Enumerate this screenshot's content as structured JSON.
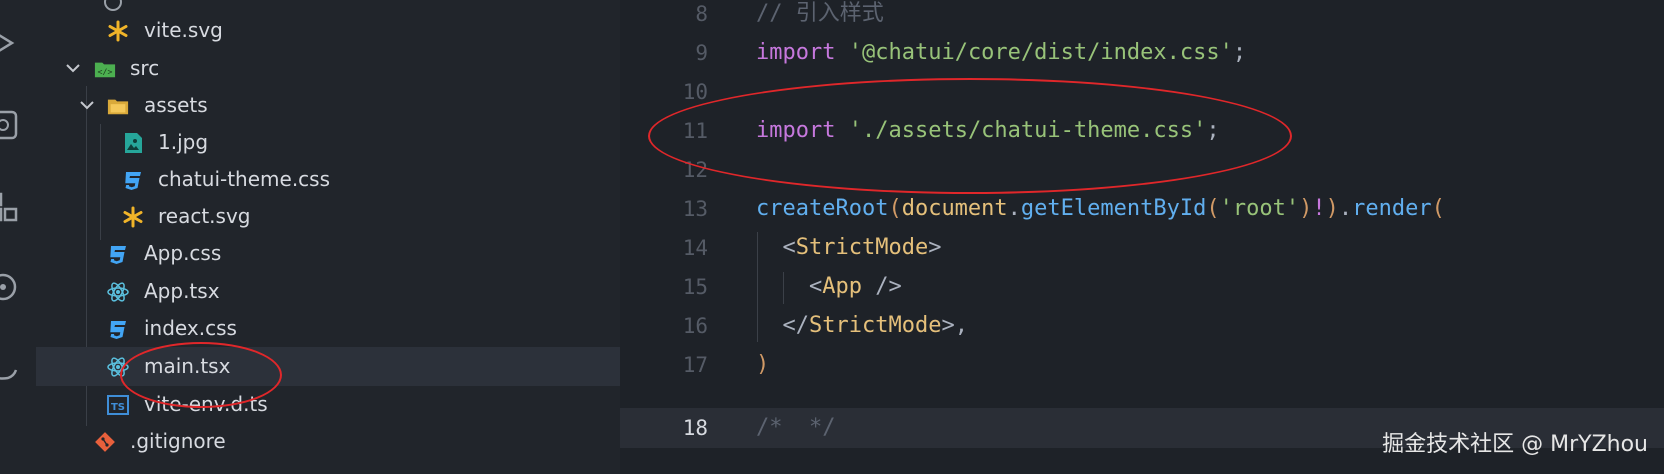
{
  "explorer": {
    "items": [
      {
        "name": "vite.svg",
        "icon": "svg-star-icon"
      },
      {
        "name": "src",
        "icon": "src-folder-icon"
      },
      {
        "name": "assets",
        "icon": "folder-open-icon"
      },
      {
        "name": "1.jpg",
        "icon": "image-file-icon"
      },
      {
        "name": "chatui-theme.css",
        "icon": "css-file-icon"
      },
      {
        "name": "react.svg",
        "icon": "svg-star-icon"
      },
      {
        "name": "App.css",
        "icon": "css-file-icon"
      },
      {
        "name": "App.tsx",
        "icon": "react-file-icon"
      },
      {
        "name": "index.css",
        "icon": "css-file-icon"
      },
      {
        "name": "main.tsx",
        "icon": "react-file-icon"
      },
      {
        "name": "vite-env.d.ts",
        "icon": "ts-file-icon"
      },
      {
        "name": ".gitignore",
        "icon": "git-file-icon"
      }
    ],
    "selected": "main.tsx"
  },
  "editor": {
    "current_line": "18",
    "lines": [
      {
        "n": "8",
        "tokens": [
          {
            "t": "// 引入样式",
            "c": "comment"
          }
        ]
      },
      {
        "n": "9",
        "tokens": [
          {
            "t": "import",
            "c": "kw"
          },
          {
            "t": " ",
            "c": "plain"
          },
          {
            "t": "'@chatui/core/dist/index.css'",
            "c": "str"
          },
          {
            "t": ";",
            "c": "plain"
          }
        ]
      },
      {
        "n": "10",
        "tokens": []
      },
      {
        "n": "11",
        "tokens": [
          {
            "t": "import",
            "c": "kw"
          },
          {
            "t": " ",
            "c": "plain"
          },
          {
            "t": "'./assets/chatui-theme.css'",
            "c": "str"
          },
          {
            "t": ";",
            "c": "plain"
          }
        ]
      },
      {
        "n": "12",
        "tokens": []
      },
      {
        "n": "13",
        "tokens": [
          {
            "t": "createRoot",
            "c": "fn"
          },
          {
            "t": "(",
            "c": "paren"
          },
          {
            "t": "document",
            "c": "var"
          },
          {
            "t": ".",
            "c": "plain"
          },
          {
            "t": "getElementById",
            "c": "fn"
          },
          {
            "t": "(",
            "c": "paren"
          },
          {
            "t": "'root'",
            "c": "str"
          },
          {
            "t": ")",
            "c": "paren"
          },
          {
            "t": "!",
            "c": "kw"
          },
          {
            "t": ")",
            "c": "paren"
          },
          {
            "t": ".",
            "c": "plain"
          },
          {
            "t": "render",
            "c": "fn"
          },
          {
            "t": "(",
            "c": "paren"
          }
        ]
      },
      {
        "n": "14",
        "tokens": [
          {
            "t": "  ",
            "c": "plain"
          },
          {
            "t": "<",
            "c": "plain"
          },
          {
            "t": "StrictMode",
            "c": "tag"
          },
          {
            "t": ">",
            "c": "plain"
          }
        ]
      },
      {
        "n": "15",
        "tokens": [
          {
            "t": "    ",
            "c": "plain"
          },
          {
            "t": "<",
            "c": "plain"
          },
          {
            "t": "App",
            "c": "tag"
          },
          {
            "t": " />",
            "c": "plain"
          }
        ]
      },
      {
        "n": "16",
        "tokens": [
          {
            "t": "  ",
            "c": "plain"
          },
          {
            "t": "</",
            "c": "plain"
          },
          {
            "t": "StrictMode",
            "c": "tag"
          },
          {
            "t": ">,",
            "c": "plain"
          }
        ]
      },
      {
        "n": "17",
        "tokens": [
          {
            "t": ")",
            "c": "paren"
          }
        ]
      },
      {
        "n": "18",
        "tokens": [
          {
            "t": "/*  */",
            "c": "comment"
          }
        ]
      }
    ]
  },
  "watermark": "掘金技术社区 @ MrYZhou",
  "colors": {
    "keyword": "#c678dd",
    "string": "#98c379",
    "function": "#61afef",
    "variable": "#e5c07b",
    "comment": "#5c6370",
    "annotation": "#e0272a"
  }
}
